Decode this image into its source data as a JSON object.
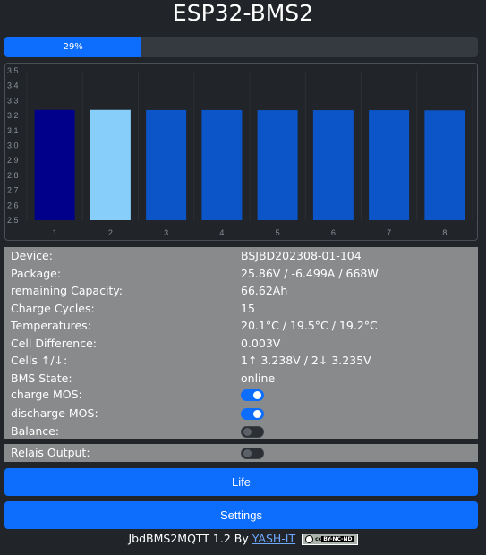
{
  "header": {
    "title": "ESP32-BMS2"
  },
  "soc": {
    "percent": 29,
    "label": "29%",
    "color": "#0d6efd"
  },
  "chart_data": {
    "type": "bar",
    "categories": [
      "1",
      "2",
      "3",
      "4",
      "5",
      "6",
      "7",
      "8"
    ],
    "values": [
      3.238,
      3.238,
      3.237,
      3.237,
      3.236,
      3.236,
      3.236,
      3.235
    ],
    "colors": [
      "#00008b",
      "#87cefa",
      "#0b55c8",
      "#0b55c8",
      "#0b55c8",
      "#0b55c8",
      "#0b55c8",
      "#0b55c8"
    ],
    "ylim": [
      2.5,
      3.5
    ],
    "yticks": [
      "3.5",
      "3.4",
      "3.3",
      "3.2",
      "3.1",
      "3.0",
      "2.9",
      "2.8",
      "2.7",
      "2.6",
      "2.5"
    ],
    "grid": true,
    "legend": "none"
  },
  "info": {
    "device": {
      "label": "Device:",
      "value": "BSJBD202308-01-104"
    },
    "package": {
      "label": "Package:",
      "value": "25.86V / -6.499A / 668W"
    },
    "capacity": {
      "label": "remaining Capacity:",
      "value": "66.62Ah"
    },
    "cycles": {
      "label": "Charge Cycles:",
      "value": "15"
    },
    "temps": {
      "label": "Temperatures:",
      "value": "20.1°C / 19.5°C / 19.2°C"
    },
    "diff": {
      "label": "Cell Difference:",
      "value": "0.003V"
    },
    "cells": {
      "label": "Cells ↑/↓:",
      "value": "1↑ 3.238V / 2↓ 3.235V"
    },
    "state": {
      "label": "BMS State:",
      "value": "online"
    },
    "charge_mos": {
      "label": "charge MOS:",
      "on": true
    },
    "discharge_mos": {
      "label": "discharge MOS:",
      "on": true
    },
    "balance": {
      "label": "Balance:",
      "on": false
    }
  },
  "relais": {
    "label": "Relais Output:",
    "on": false
  },
  "buttons": {
    "life": "Life",
    "settings": "Settings"
  },
  "footer": {
    "text": "JbdBMS2MQTT 1.2 By",
    "link": "YASH-IT",
    "license_a": "cc",
    "license_b": "BY-NC-ND"
  }
}
